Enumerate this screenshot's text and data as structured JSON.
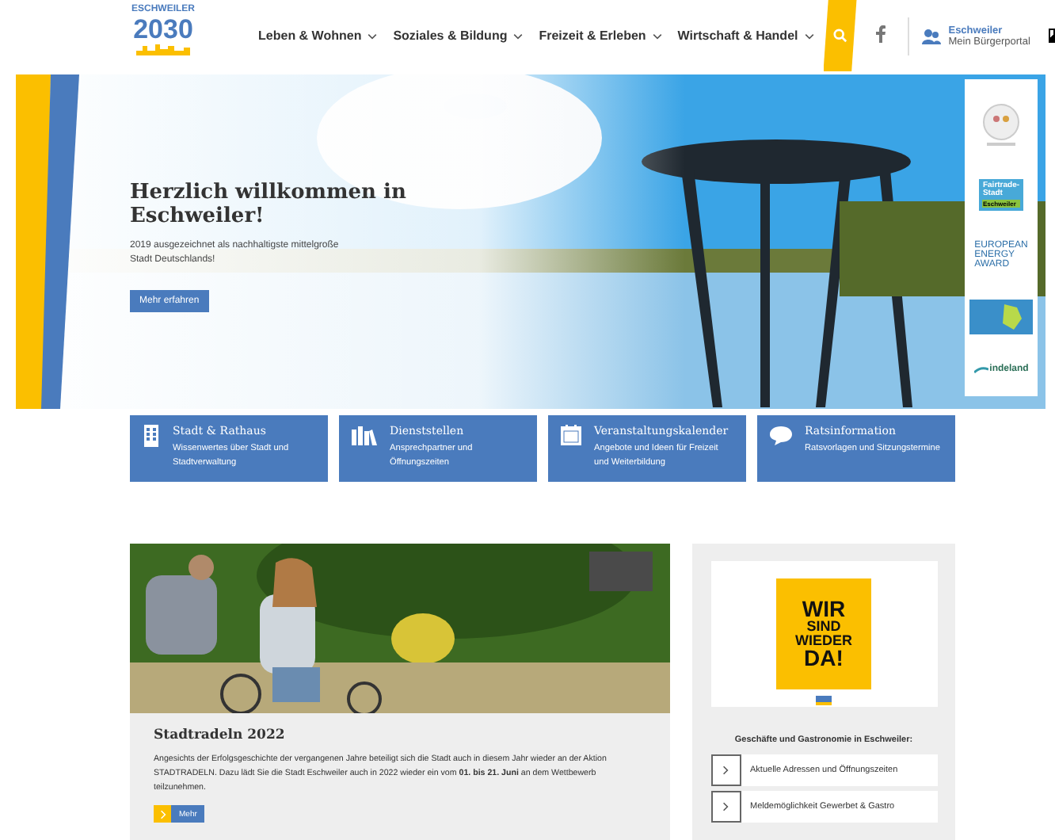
{
  "logo": {
    "top": "ESCHWEILER",
    "year": "2030"
  },
  "nav": [
    {
      "label": "Leben & Wohnen"
    },
    {
      "label": "Soziales & Bildung"
    },
    {
      "label": "Freizeit & Erleben"
    },
    {
      "label": "Wirtschaft & Handel"
    }
  ],
  "portal": {
    "title": "Eschweiler",
    "subtitle": "Mein Bürgerportal"
  },
  "hero": {
    "title": "Herzlich willkommen in Eschweiler!",
    "text": "2019 ausgezeichnet als nachhaltigste mittelgroße Stadt Deutschlands!",
    "button": "Mehr erfahren"
  },
  "awards": [
    {
      "kind": "medal"
    },
    {
      "kind": "fairtrade",
      "lines": [
        "Fairtrade-",
        "Stadt"
      ],
      "tag": "Eschweiler"
    },
    {
      "kind": "energy",
      "lines": [
        "EUROPEAN",
        "ENERGY",
        "AWARD"
      ]
    },
    {
      "kind": "map"
    },
    {
      "kind": "indeland",
      "label": "indeland"
    }
  ],
  "tiles": [
    {
      "kind": "building",
      "title": "Stadt & Rathaus",
      "text": "Wissenwertes über Stadt und Stadtverwaltung"
    },
    {
      "kind": "books",
      "title": "Dienststellen",
      "text": "Ansprechpartner und Öffnungszeiten"
    },
    {
      "kind": "calendar",
      "title": "Veranstaltungskalender",
      "text": "Angebote und Ideen für Freizeit und Weiterbildung"
    },
    {
      "kind": "chat",
      "title": "Ratsinformation",
      "text": "Ratsvorlagen und Sitzungstermine"
    }
  ],
  "news": {
    "title": "Stadtradeln 2022",
    "text": "Angesichts der Erfolgsgeschichte der vergangenen Jahre beteiligt sich die Stadt auch in diesem Jahr wieder an der Aktion STADTRADELN. Dazu lädt Sie die Stadt Eschweiler auch in 2022 wieder ein vom **01. bis 21. Juni** an dem Wettbewerb teilzunehmen.",
    "button": "Mehr"
  },
  "sidebar": {
    "poster": [
      "WIR",
      "SIND",
      "WIEDER",
      "DA!"
    ],
    "heading": "Geschäfte und Gastronomie in Eschweiler:",
    "links": [
      "Aktuelle Adressen und Öffnungszeiten",
      "Meldemöglichkeit Gewerbet & Gastro"
    ]
  }
}
